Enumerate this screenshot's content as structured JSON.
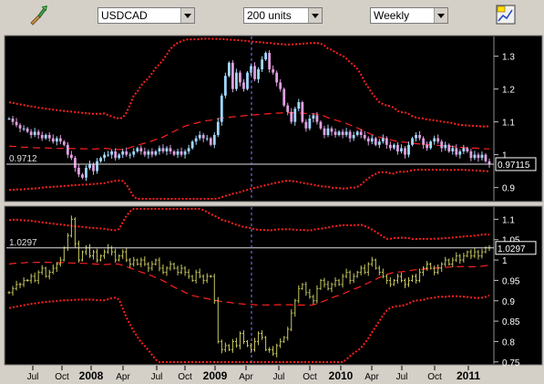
{
  "toolbar": {
    "symbol": "USDCAD",
    "units": "200 units",
    "period": "Weekly",
    "icons": [
      "paint-tool-icon",
      "chart-options-icon"
    ]
  },
  "chart_data": [
    {
      "type": "candlestick",
      "title": "",
      "xlabel": "",
      "ylabel": "",
      "ylim": [
        0.86,
        1.36
      ],
      "yticks": [
        1.3,
        1.2,
        1.1,
        1,
        0.9
      ],
      "price_label": "0.97115",
      "level_label": "0.9712",
      "level": 0.9712,
      "grid": false,
      "close": [
        1.11,
        1.1,
        1.09,
        1.08,
        1.08,
        1.07,
        1.06,
        1.07,
        1.06,
        1.05,
        1.06,
        1.05,
        1.04,
        1.05,
        1.04,
        1.03,
        1.0,
        0.99,
        0.96,
        0.94,
        0.93,
        0.96,
        0.97,
        0.95,
        0.98,
        0.99,
        1.0,
        1.0,
        1.01,
        0.99,
        1.0,
        1.01,
        1.0,
        1.0,
        1.01,
        1.02,
        1.01,
        1.0,
        1.01,
        1.0,
        1.01,
        1.02,
        1.01,
        1.02,
        1.01,
        1.0,
        1.01,
        1.0,
        1.01,
        1.02,
        1.04,
        1.05,
        1.06,
        1.05,
        1.05,
        1.03,
        1.06,
        1.1,
        1.18,
        1.24,
        1.28,
        1.2,
        1.25,
        1.22,
        1.2,
        1.25,
        1.27,
        1.23,
        1.26,
        1.29,
        1.31,
        1.26,
        1.25,
        1.22,
        1.2,
        1.15,
        1.13,
        1.1,
        1.14,
        1.16,
        1.1,
        1.08,
        1.11,
        1.12,
        1.1,
        1.08,
        1.06,
        1.08,
        1.07,
        1.06,
        1.07,
        1.06,
        1.07,
        1.05,
        1.06,
        1.07,
        1.06,
        1.05,
        1.04,
        1.05,
        1.03,
        1.04,
        1.05,
        1.03,
        1.02,
        1.03,
        1.01,
        1.02,
        1.0,
        1.03,
        1.05,
        1.06,
        1.05,
        1.03,
        1.02,
        1.04,
        1.05,
        1.04,
        1.02,
        1.03,
        1.01,
        1.02,
        1.0,
        1.01,
        1.02,
        1.01,
        0.99,
        1.0,
        0.99,
        1.0,
        0.98,
        0.97
      ]
    },
    {
      "type": "ohlc",
      "title": "",
      "xlabel": "",
      "ylabel": "",
      "ylim": [
        0.745,
        1.13
      ],
      "yticks": [
        1.1,
        1.05,
        1,
        0.95,
        0.9,
        0.85,
        0.8,
        0.75
      ],
      "price_label": "1.0297",
      "level_label": "1.0297",
      "level": 1.0297,
      "grid": false,
      "close": [
        0.92,
        0.93,
        0.94,
        0.94,
        0.95,
        0.95,
        0.96,
        0.95,
        0.97,
        0.98,
        0.96,
        0.97,
        0.98,
        0.99,
        1.0,
        1.03,
        1.06,
        1.1,
        1.04,
        1.0,
        1.02,
        1.03,
        1.01,
        1.02,
        1.0,
        1.01,
        1.02,
        1.03,
        1.02,
        1.0,
        1.01,
        1.02,
        1.0,
        0.99,
        1.0,
        0.99,
        1.0,
        0.99,
        0.98,
        0.99,
        1.0,
        0.98,
        0.97,
        0.98,
        0.99,
        0.98,
        0.97,
        0.98,
        0.97,
        0.96,
        0.95,
        0.97,
        0.96,
        0.95,
        0.96,
        0.96,
        0.9,
        0.8,
        0.78,
        0.79,
        0.78,
        0.8,
        0.79,
        0.82,
        0.8,
        0.79,
        0.78,
        0.8,
        0.82,
        0.81,
        0.78,
        0.78,
        0.77,
        0.79,
        0.8,
        0.81,
        0.83,
        0.87,
        0.9,
        0.93,
        0.94,
        0.92,
        0.91,
        0.9,
        0.93,
        0.95,
        0.94,
        0.93,
        0.94,
        0.95,
        0.94,
        0.96,
        0.97,
        0.95,
        0.96,
        0.97,
        0.98,
        0.97,
        0.99,
        1.0,
        0.98,
        0.97,
        0.96,
        0.95,
        0.94,
        0.95,
        0.96,
        0.95,
        0.94,
        0.95,
        0.96,
        0.95,
        0.97,
        0.98,
        0.99,
        0.98,
        0.97,
        0.98,
        0.99,
        1.0,
        0.99,
        1.0,
        1.01,
        1.0,
        1.01,
        1.02,
        1.01,
        1.02,
        1.01,
        1.02,
        1.03,
        1.03
      ]
    }
  ],
  "xaxis": {
    "labels": [
      {
        "text": "Jul",
        "bold": false
      },
      {
        "text": "Oct",
        "bold": false
      },
      {
        "text": "2008",
        "bold": true
      },
      {
        "text": "Apr",
        "bold": false
      },
      {
        "text": "Jul",
        "bold": false
      },
      {
        "text": "Oct",
        "bold": false
      },
      {
        "text": "2009",
        "bold": true
      },
      {
        "text": "Apr",
        "bold": false
      },
      {
        "text": "Jul",
        "bold": false
      },
      {
        "text": "Oct",
        "bold": false
      },
      {
        "text": "2010",
        "bold": true
      },
      {
        "text": "Apr",
        "bold": false
      },
      {
        "text": "Jul",
        "bold": false
      },
      {
        "text": "Oct",
        "bold": false
      },
      {
        "text": "2011",
        "bold": true
      }
    ]
  },
  "colors": {
    "background": "#000000",
    "band": "#ff2020",
    "up_candle": "#a0d8ff",
    "down_candle": "#e0a0e0",
    "ohlc": "#c8c860",
    "cursor": "#8080ff",
    "axis_text": "#ffffff"
  }
}
